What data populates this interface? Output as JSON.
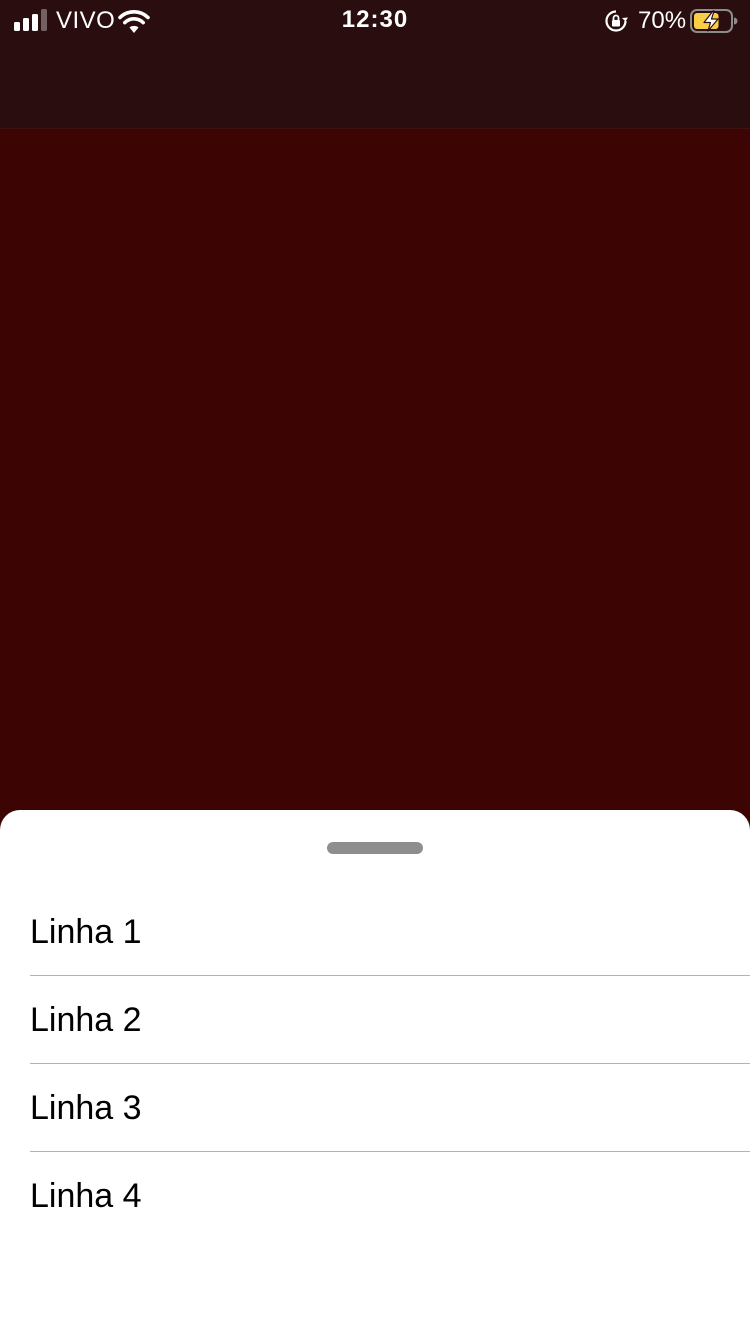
{
  "status_bar": {
    "carrier": "VIVO",
    "time": "12:30",
    "battery_percent": "70%",
    "battery_level": 0.7,
    "signal_bars": 3,
    "signal_bars_total": 4,
    "battery_color": "#f7ce46",
    "icons": [
      "signal-icon",
      "wifi-icon",
      "orientation-lock-icon",
      "battery-charging-icon"
    ]
  },
  "colors": {
    "background": "#3c0504",
    "nav_bar": "#2a0e0f",
    "sheet": "#ffffff",
    "grabber": "#8e8e8e"
  },
  "sheet": {
    "rows": [
      {
        "label": "Linha 1"
      },
      {
        "label": "Linha 2"
      },
      {
        "label": "Linha 3"
      },
      {
        "label": "Linha 4"
      }
    ]
  }
}
